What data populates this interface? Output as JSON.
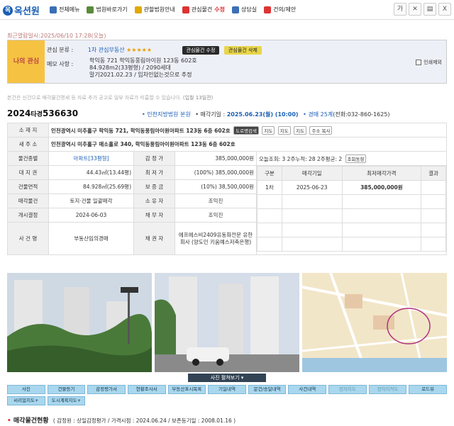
{
  "logo": {
    "text": "옥션원"
  },
  "nav": [
    "전체메뉴",
    "법원바로가기",
    "관할법원안내",
    "관심물건",
    "상담실",
    "건의/제안"
  ],
  "nav_hl": "수정",
  "tools": [
    "가",
    "",
    "",
    ""
  ],
  "recent": "최근열람일시:2025/06/10 17:28(오늘)",
  "my": {
    "label": "나의 관심",
    "cat_label": "관심 분류 :",
    "cat_value": "1차 관심부동산",
    "stars": "★★★★★",
    "btn_edit": "관심물건 수정",
    "btn_del": "관심물건 삭제",
    "memo_label": "메모 사항 :",
    "memo1": "학익동 721 학익동풍림아이원 123동 602호",
    "memo2": "84.928m2(33평형) / 2090세대",
    "memo3": "말기2021.02.23 / 임차인없는것으로 추정",
    "print": "인쇄제외"
  },
  "note": "본건은 신건으로 매각물건명세 등 자료 추가 공고로 일부 자료가 미흡할 수 있습니다.",
  "note_link": "(입찰 13일전)",
  "case": {
    "year": "2024",
    "mid": "타경",
    "num": "536630"
  },
  "caseinfo": {
    "court": "• 인천지방법원 본원",
    "date_label": "• 매각기일 :",
    "date": "2025.06.23(월) (10:00)",
    "dept_label": "• 경매 25계",
    "tel": "(전화:032-860-1625)"
  },
  "info": {
    "h_addr": "소 재 지",
    "addr": "인천광역시 미추홀구 학익동 721, 학익동풍림아이원아파트 123동 6층 602호",
    "tags": [
      "도로명검색",
      "지도",
      "지도",
      "지도",
      "주소 복사"
    ],
    "h_new": "새 주 소",
    "new_addr": "인천광역시 미추홀구 매소홀로 340, 학익동풍림아이원아파트 123동 6층 602호",
    "h_type": "물건종별",
    "type": "아파트[33평형]",
    "h_appr": "감 정 가",
    "appr": "385,000,000원",
    "views": "오늘조회: 3  2주누적: 28  2주평균: 2",
    "trend": "조회동향",
    "h_land": "대 지 권",
    "land": "44.43㎡(13.44평)",
    "h_min": "최 저 가",
    "min": "(100%) 385,000,000원",
    "h_bld": "건물면적",
    "bld": "84.928㎡(25.69평)",
    "h_dep": "보 증 금",
    "dep": "(10%) 38,500,000원",
    "h_sale": "매각물건",
    "sale": "토지·건물 일괄매각",
    "h_own": "소 유 자",
    "own": "조익진",
    "h_start": "개시결정",
    "start": "2024-06-03",
    "h_debtor": "채 무 자",
    "debtor": "조익진",
    "h_case": "사 건 명",
    "case": "부동산임의경매",
    "h_cred": "채 권 자",
    "cred": "에프에스비2409유동화전문 유한회사 (양도인 키움예스저축은행)"
  },
  "bid": {
    "headers": [
      "구분",
      "매각기일",
      "최저매각가격",
      "결과"
    ],
    "rows": [
      [
        "1차",
        "2025-06-23",
        "385,000,000원",
        ""
      ]
    ]
  },
  "photo_btn": "사진 펼쳐보기",
  "menu": [
    "사진",
    "건물등기",
    "감정평가서",
    "현황조사서",
    "부동산표시목록",
    "기일내역",
    "문건/송달내역",
    "사건내역",
    "전자지도",
    "전자지적도",
    "로드뷰",
    "씨리얼지도+",
    "도시계획지도+"
  ],
  "menu_inactive": [
    8,
    9
  ],
  "sect": {
    "title": "매각물건현황",
    "sub": "( 감정원 : 상일감정평가 / 가격시점 : 2024.06.24 / 보존등기일 : 2008.01.16 )"
  }
}
